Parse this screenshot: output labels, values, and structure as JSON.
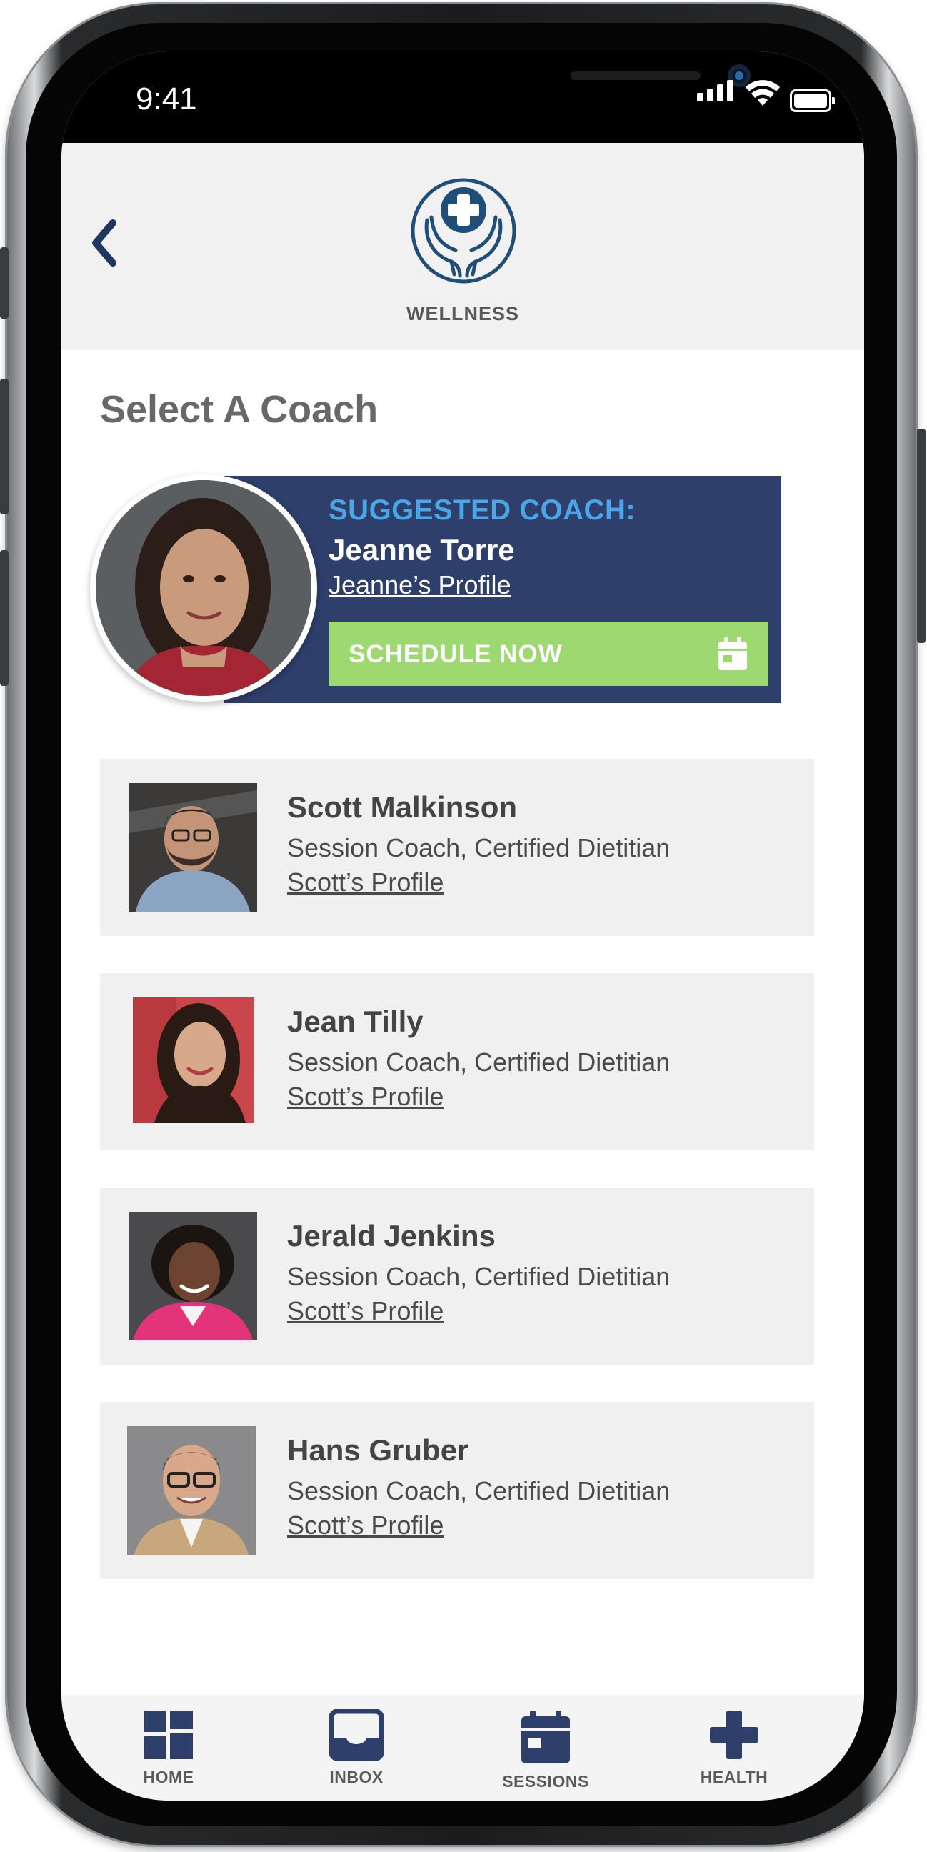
{
  "status_bar": {
    "time": "9:41"
  },
  "header": {
    "logo_label": "WELLNESS",
    "logo_icon": "hands-cross-icon",
    "back_icon": "chevron-left-icon"
  },
  "page": {
    "title": "Select A Coach"
  },
  "suggested": {
    "label": "SUGGESTED COACH:",
    "name": "Jeanne Torre",
    "profile_link": "Jeanne’s Profile",
    "schedule_label": "SCHEDULE NOW",
    "schedule_icon": "calendar-icon"
  },
  "coaches": [
    {
      "name": "Scott Malkinson",
      "role": "Session Coach, Certified Dietitian",
      "profile_link": "Scott’s Profile"
    },
    {
      "name": "Jean Tilly",
      "role": "Session Coach, Certified Dietitian",
      "profile_link": "Scott’s Profile"
    },
    {
      "name": "Jerald Jenkins",
      "role": "Session Coach, Certified Dietitian",
      "profile_link": "Scott’s Profile"
    },
    {
      "name": "Hans Gruber",
      "role": "Session Coach, Certified Dietitian",
      "profile_link": "Scott’s Profile"
    }
  ],
  "tabbar": {
    "home": "HOME",
    "inbox": "INBOX",
    "sessions": "SESSIONS",
    "health": "HEALTH"
  },
  "colors": {
    "brand_navy": "#2e3f6b",
    "accent_blue": "#4ba6e8",
    "schedule_green": "#9ed870",
    "header_bg": "#f1f1f1",
    "card_bg": "#f0f0f0"
  }
}
